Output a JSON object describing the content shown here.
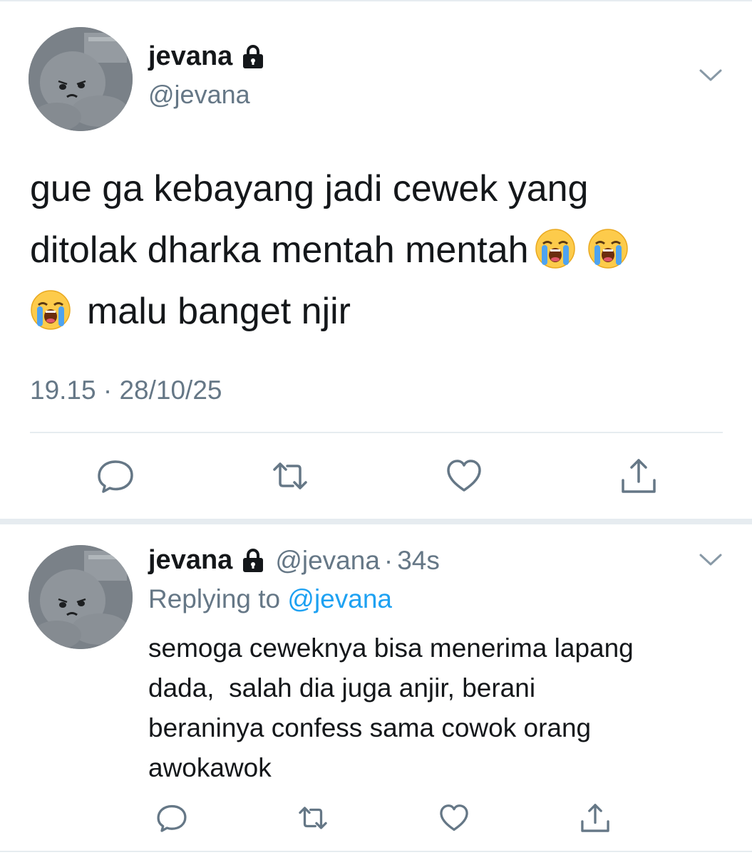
{
  "main_tweet": {
    "display_name": "jevana",
    "handle": "@jevana",
    "text_line1": "gue ga kebayang jadi cewek yang",
    "text_line2": "ditolak dharka mentah mentah",
    "text_line3": "malu banget njir",
    "emoji": "loudly-crying-face",
    "timestamp": "19.15 · 28/10/25"
  },
  "reply": {
    "display_name": "jevana",
    "handle": "@jevana",
    "separator": "·",
    "age": "34s",
    "replying_prefix": "Replying to",
    "replying_mention": "@jevana",
    "text_line1": "semoga ceweknya bisa menerima lapang",
    "text_line2": "dada,  salah dia juga anjir, berani",
    "text_line3": "beraninya confess sama cowok orang",
    "text_line4": "awokawok"
  },
  "icons": {
    "lock": "lock-icon",
    "menu": "chevron-down-icon",
    "reply": "reply-icon",
    "retweet": "retweet-icon",
    "like": "heart-icon",
    "share": "share-icon"
  },
  "colors": {
    "text": "#14171a",
    "secondary": "#657786",
    "link": "#1da1f2",
    "divider": "#e6ecf0"
  }
}
